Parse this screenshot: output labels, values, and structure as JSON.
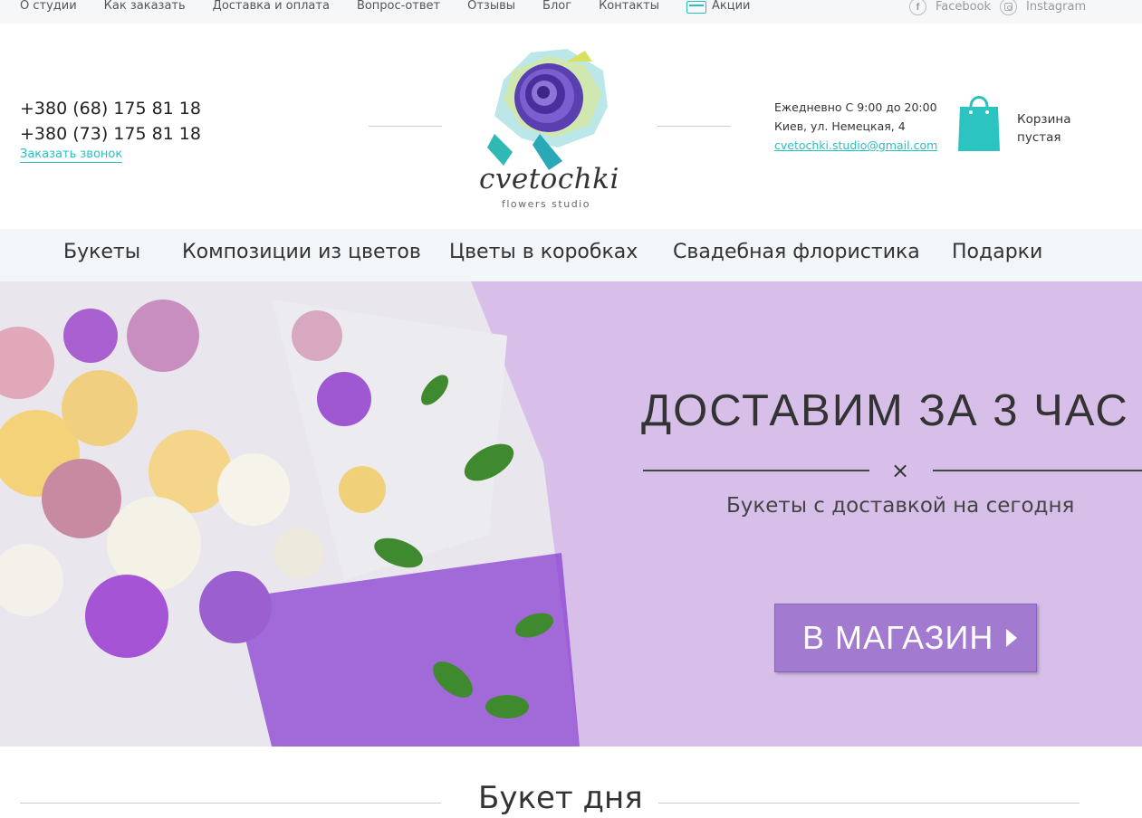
{
  "topbar": {
    "nav": [
      "О студии",
      "Как заказать",
      "Доставка и оплата",
      "Вопрос-ответ",
      "Отзывы",
      "Блог",
      "Контакты"
    ],
    "promo_label": "Акции",
    "facebook": "Facebook",
    "instagram": "Instagram"
  },
  "header": {
    "phone1": "+380 (68) 175 81 18",
    "phone2": "+380 (73) 175 81 18",
    "callback": "Заказать звонок",
    "logo_word": "cvetochki",
    "logo_sub": "flowers studio",
    "hours": "Ежедневно С 9:00 до 20:00",
    "address": "Киев, ул. Немецкая, 4",
    "email": "cvetochki.studio@gmail.com",
    "cart_line1": "Корзина",
    "cart_line2": "пустая"
  },
  "mainnav": [
    "Букеты",
    "Композиции из цветов",
    "Цветы в коробках",
    "Свадебная флористика",
    "Подарки"
  ],
  "banner": {
    "title": "ДОСТАВИМ ЗА 3 ЧАС",
    "divider": "×",
    "subtitle": "Букеты с доставкой на сегодня",
    "button": "В МАГАЗИН"
  },
  "section": {
    "title": "Букет дня"
  },
  "colors": {
    "accent": "#2bbfbf",
    "banner_bg": "#d7bfe9",
    "button": "#a27bd0"
  }
}
